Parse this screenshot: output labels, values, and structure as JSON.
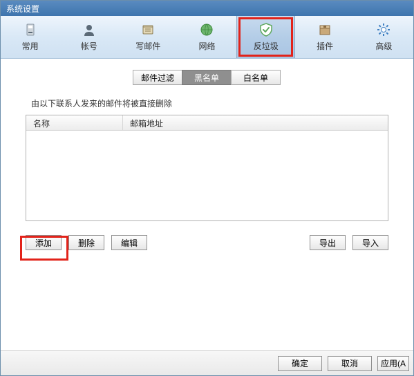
{
  "window": {
    "title": "系统设置"
  },
  "toolbar": {
    "items": [
      {
        "label": "常用"
      },
      {
        "label": "帐号"
      },
      {
        "label": "写邮件"
      },
      {
        "label": "网络"
      },
      {
        "label": "反垃圾"
      },
      {
        "label": "插件"
      },
      {
        "label": "高级"
      }
    ],
    "active_index": 4
  },
  "subtabs": {
    "items": [
      {
        "label": "邮件过滤"
      },
      {
        "label": "黑名单"
      },
      {
        "label": "白名单"
      }
    ],
    "active_index": 1
  },
  "description": "由以下联系人发来的邮件将被直接删除",
  "table": {
    "columns": {
      "name": "名称",
      "address": "邮箱地址"
    },
    "rows": []
  },
  "buttons": {
    "add": "添加",
    "delete": "删除",
    "edit": "编辑",
    "export": "导出",
    "import": "导入"
  },
  "footer": {
    "ok": "确定",
    "cancel": "取消",
    "apply": "应用(A"
  }
}
